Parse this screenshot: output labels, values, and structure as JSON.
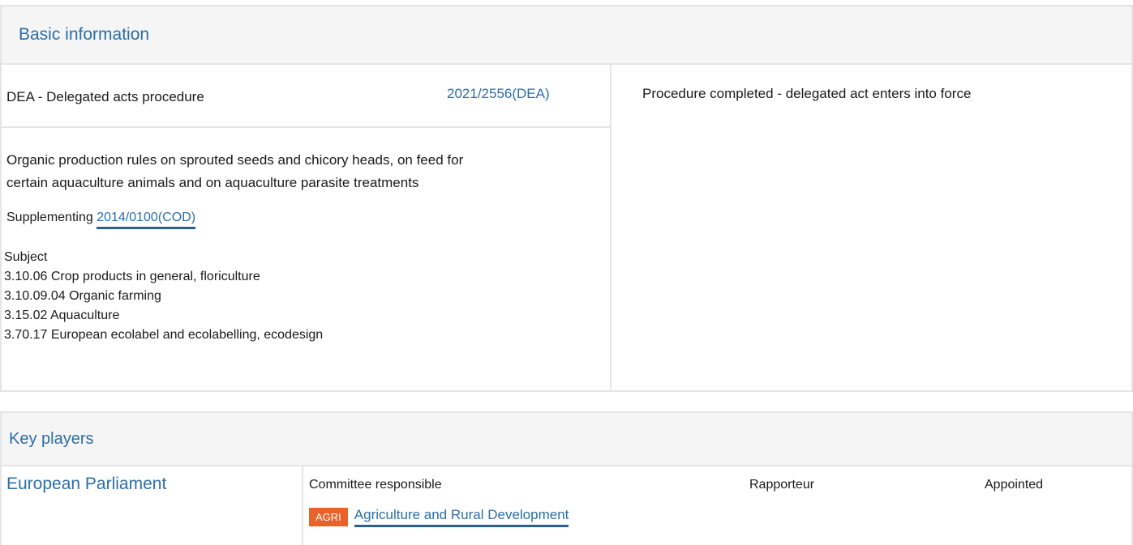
{
  "basic_info": {
    "header": "Basic information",
    "procedure_type": "DEA - Delegated acts procedure",
    "procedure_ref": "2021/2556(DEA)",
    "status": "Procedure completed - delegated act enters into force",
    "title_line1": "Organic production rules on sprouted seeds and chicory heads, on feed for",
    "title_line2": "certain aquaculture animals and on aquaculture parasite treatments",
    "supplementing_label": "Supplementing",
    "supplementing_ref": "2014/0100(COD)",
    "subject_label": "Subject",
    "subjects": [
      "3.10.06 Crop products in general, floriculture",
      "3.10.09.04 Organic farming",
      "3.15.02 Aquaculture",
      "3.70.17 European ecolabel and ecolabelling, ecodesign"
    ]
  },
  "key_players": {
    "header": "Key players",
    "institution": "European Parliament",
    "columns": {
      "committee": "Committee responsible",
      "rapporteur": "Rapporteur",
      "appointed": "Appointed"
    },
    "committee_badge": "AGRI",
    "committee_name": "Agriculture and Rural Development",
    "colors": {
      "badge": "#e8622a",
      "link": "#2c6ea6"
    }
  }
}
